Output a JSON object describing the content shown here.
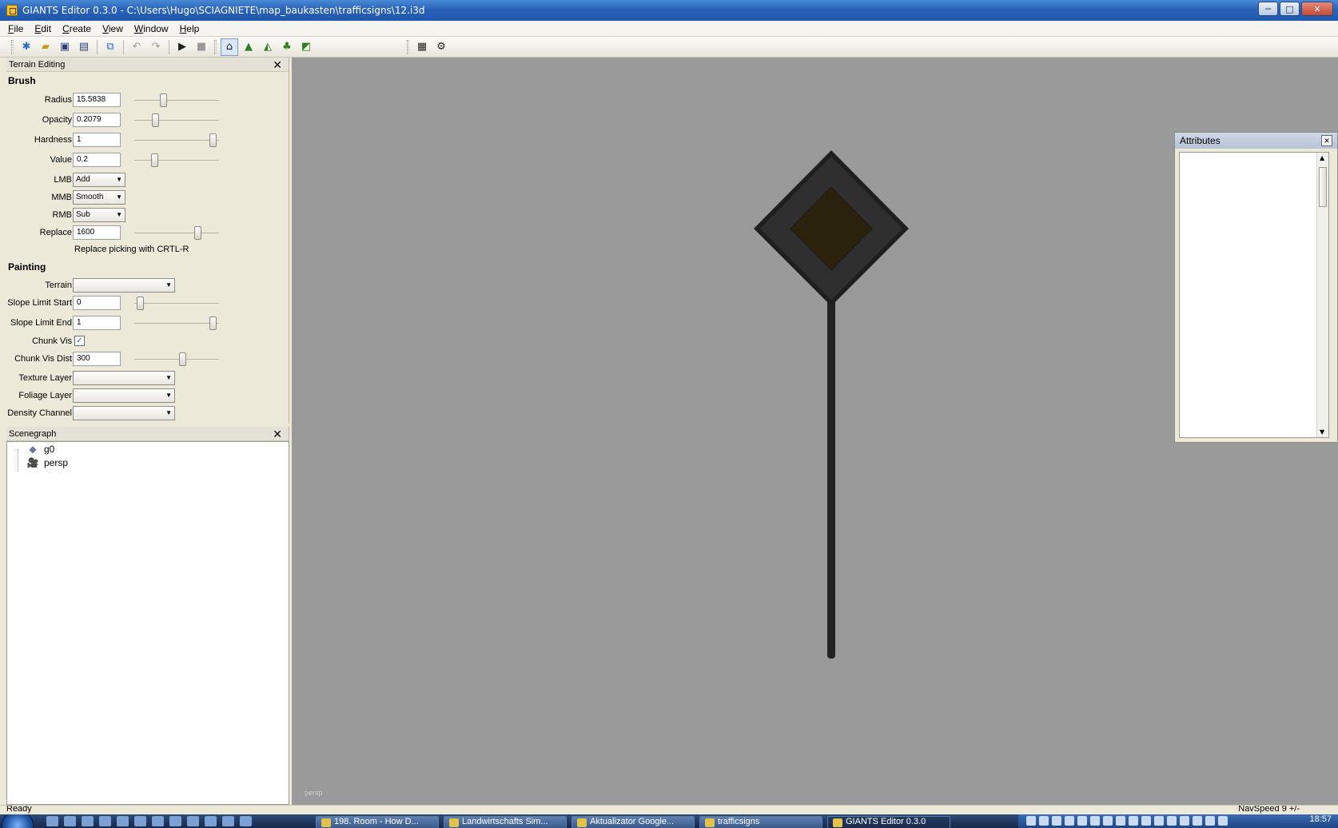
{
  "window": {
    "title": "GIANTS Editor 0.3.0 - C:\\Users\\Hugo\\SCIAGNIETE\\map_baukasten\\trafficsigns\\12.i3d",
    "controls": [
      "─",
      "□",
      "✕"
    ]
  },
  "menu": [
    "File",
    "Edit",
    "Create",
    "View",
    "Window",
    "Help"
  ],
  "toolbar": {
    "icons": [
      "new-icon",
      "open-icon",
      "save-icon",
      "save-all-icon",
      "export-icon",
      "undo-icon",
      "redo-icon",
      "play-icon",
      "stop-icon",
      "select-tool-icon",
      "terrain-sculpt-icon",
      "terrain-paint-icon",
      "foliage-paint-icon",
      "texture-paint-icon",
      "checker-icon",
      "gear-icon"
    ]
  },
  "terrain_editing": {
    "title": "Terrain Editing",
    "brush_section": "Brush",
    "radius_label": "Radius",
    "radius_value": "15.5838",
    "radius_level": 0.33,
    "opacity_label": "Opacity",
    "opacity_value": "0.2079",
    "opacity_level": 0.23,
    "hardness_label": "Hardness",
    "hardness_value": "1",
    "hardness_level": 0.97,
    "value_label": "Value",
    "value_value": "0.2",
    "value_level": 0.22,
    "lmb_label": "LMB",
    "lmb_value": "Add",
    "mmb_label": "MMB",
    "mmb_value": "Smooth",
    "rmb_label": "RMB",
    "rmb_value": "Sub",
    "replace_label": "Replace",
    "replace_value": "1600",
    "replace_level": 0.77,
    "replace_hint": "Replace picking with CRTL-R",
    "painting_section": "Painting",
    "terrain_label": "Terrain",
    "terrain_value": "",
    "slope_start_label": "Slope Limit Start",
    "slope_start_value": "0",
    "slope_start_level": 0.03,
    "slope_end_label": "Slope Limit End",
    "slope_end_value": "1",
    "slope_end_level": 0.97,
    "chunk_vis_label": "Chunk Vis",
    "chunk_vis_checked": true,
    "chunk_vis_dist_label": "Chunk Vis Dist",
    "chunk_vis_dist_value": "300",
    "chunk_vis_dist_level": 0.58,
    "texture_layer_label": "Texture Layer",
    "texture_layer_value": "",
    "foliage_layer_label": "Foliage Layer",
    "foliage_layer_value": "",
    "density_channel_label": "Density Channel"
  },
  "scenegraph": {
    "title": "Scenegraph",
    "items": [
      {
        "label": "g0",
        "icon": "cube-icon"
      },
      {
        "label": "persp",
        "icon": "camera-icon"
      }
    ]
  },
  "viewport": {
    "camera_label": "persp",
    "background": "#9a9a9a",
    "sign_colors": {
      "border": "#1f1f1f",
      "face": "#2f2f2f",
      "inner": "#2a220d",
      "pole": "#232323"
    }
  },
  "attributes": {
    "title": "Attributes"
  },
  "status": {
    "left": "Ready",
    "right": "NavSpeed 9 +/-"
  },
  "taskbar": {
    "tasks": [
      {
        "label": "198. Room - How D..."
      },
      {
        "label": "Landwirtschafts Sim..."
      },
      {
        "label": "Aktualizator Google..."
      },
      {
        "label": "trafficsigns"
      },
      {
        "label": "GIANTS Editor 0.3.0"
      }
    ],
    "clock": "18:57"
  }
}
